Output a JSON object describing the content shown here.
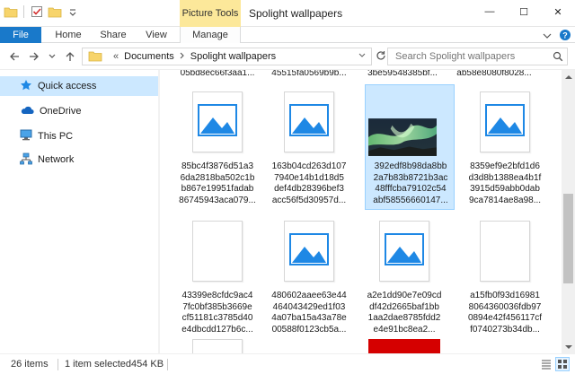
{
  "titlebar": {
    "context_tab": "Picture Tools",
    "title": "Spolight wallpapers",
    "minimize": "—",
    "maximize": "☐",
    "close": "✕"
  },
  "ribbon": {
    "tabs": [
      "File",
      "Home",
      "Share",
      "View",
      "Manage"
    ]
  },
  "address": {
    "overflow": "«",
    "crumbs": [
      "Documents",
      "Spolight wallpapers"
    ],
    "search_placeholder": "Search Spolight wallpapers"
  },
  "nav": {
    "items": [
      "Quick access",
      "OneDrive",
      "This PC",
      "Network"
    ]
  },
  "files": {
    "row0": [
      "05bd8ec66f3aa1...",
      "45515fa0569b9b...",
      "3be59548385bf...",
      "ab58e8080f8028..."
    ],
    "row1": [
      [
        "85bc4f3876d51a3",
        "6da2818ba502c1b",
        "b867e19951fadab",
        "86745943aca079..."
      ],
      [
        "163b04cd263d107",
        "7940e14b1d18d5",
        "def4db28396bef3",
        "acc56f5d30957d..."
      ],
      [
        "392edf8b98da8bb",
        "2a7b83b8721b3ac",
        "48fffcba79102c54",
        "abf58556660147..."
      ],
      [
        "8359ef9e2bfd1d6",
        "d3d8b1388ea4b1f",
        "3915d59abb0dab",
        "9ca7814ae8a98..."
      ]
    ],
    "row2": [
      [
        "43399e8cfdc9ac4",
        "7fc0bf385b3669e",
        "cf51181c3785d40",
        "e4dbcdd127b6c..."
      ],
      [
        "480602aaee63e44",
        "464043429ed1f03",
        "4a07ba15a43a78e",
        "00588f0123cb5a..."
      ],
      [
        "a2e1dd90e7e09cd",
        "df42d2665baf1bb",
        "1aa2dae8785fdd2",
        "e4e91bc8ea2..."
      ],
      [
        "a15fb0f93d16981",
        "8064360036fdb97",
        "0894e42f456117cf",
        "f0740273b34db..."
      ]
    ]
  },
  "status": {
    "count": "26 items",
    "selection": "1 item selected",
    "size": "454 KB"
  },
  "colors": {
    "accent": "#1979ca",
    "context_tab": "#fce89a",
    "selection": "#cce8ff",
    "image_icon": "#1e88e5"
  }
}
